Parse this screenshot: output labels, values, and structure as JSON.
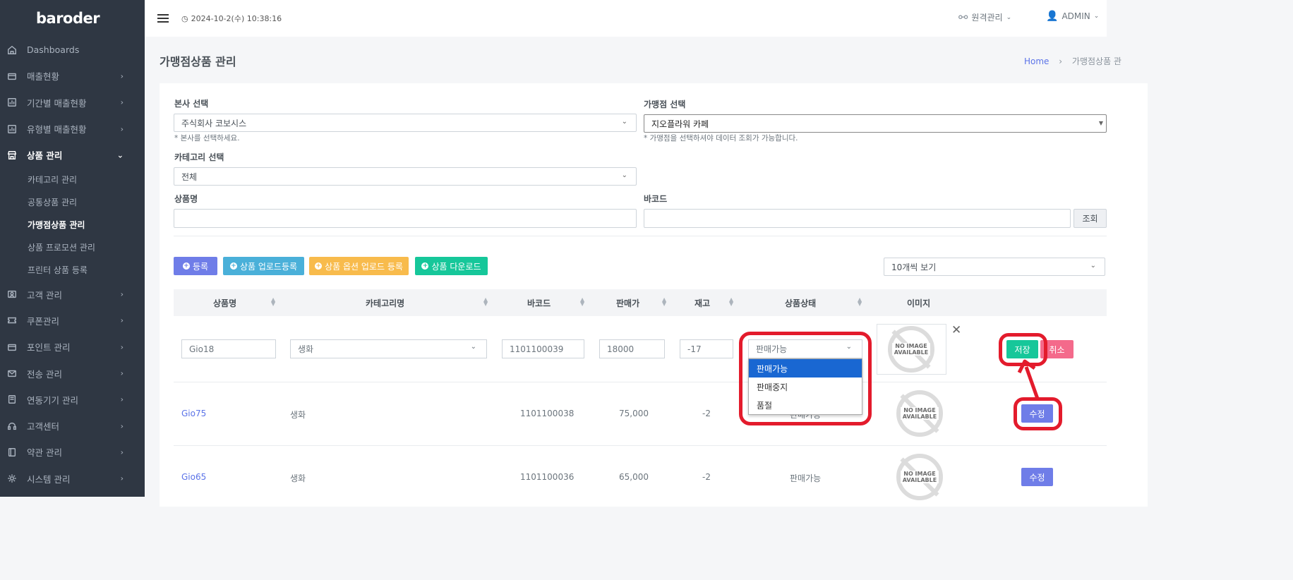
{
  "app": {
    "logo": "baroder"
  },
  "topbar": {
    "datetime": "2024-10-2(수) 10:38:16",
    "remote": "원격관리",
    "admin": "ADMIN"
  },
  "sidebar": {
    "items": [
      {
        "label": "Dashboards",
        "icon": "home-icon"
      },
      {
        "label": "매출현황",
        "icon": "wallet-icon"
      },
      {
        "label": "기간별 매출현황",
        "icon": "chart-icon"
      },
      {
        "label": "유형별 매출현황",
        "icon": "chart-icon"
      },
      {
        "label": "상품 관리",
        "icon": "store-icon"
      },
      {
        "label": "고객 관리",
        "icon": "user-card-icon"
      },
      {
        "label": "쿠폰관리",
        "icon": "ticket-icon"
      },
      {
        "label": "포인트 관리",
        "icon": "wallet-icon"
      },
      {
        "label": "전송 관리",
        "icon": "mail-icon"
      },
      {
        "label": "연동기기 관리",
        "icon": "device-icon"
      },
      {
        "label": "고객센터",
        "icon": "headset-icon"
      },
      {
        "label": "약관 관리",
        "icon": "book-icon"
      },
      {
        "label": "시스템 관리",
        "icon": "gear-icon"
      }
    ],
    "subitems": [
      "카테고리 관리",
      "공통상품 관리",
      "가맹점상품 관리",
      "상품 프로모션 관리",
      "프린터 상품 등록"
    ]
  },
  "page": {
    "title": "가맹점상품 관리",
    "breadcrumb_home": "Home",
    "breadcrumb_sep": "›",
    "breadcrumb_current": "가맹점상품 관"
  },
  "filters": {
    "hq_label": "본사 선택",
    "hq_value": "주식회사 코보시스",
    "hq_hint": "* 본사를 선택하세요.",
    "store_label": "가맹점 선택",
    "store_value": "지오플라워 카페",
    "store_hint": "* 가맹점을 선택하셔야 데이터 조회가 가능합니다.",
    "category_label": "카테고리 선택",
    "category_value": "전체",
    "name_label": "상품명",
    "name_value": "",
    "barcode_label": "바코드",
    "barcode_value": "",
    "search_button": "조회"
  },
  "actions": {
    "register": "등록",
    "upload": "상품 업로드등록",
    "option_upload": "상품 옵션 업로드 등록",
    "download": "상품 다운로드",
    "page_size": "10개씩 보기"
  },
  "table": {
    "headers": [
      "상품명",
      "카테고리명",
      "바코드",
      "판매가",
      "재고",
      "상품상태",
      "이미지"
    ],
    "edit_row": {
      "name": "Gio18",
      "category": "생화",
      "barcode": "1101100039",
      "price": "18000",
      "stock": "-17",
      "status": "판매가능",
      "save": "저장",
      "cancel": "취소"
    },
    "status_options": [
      "판매가능",
      "판매중지",
      "품절"
    ],
    "rows": [
      {
        "name": "Gio75",
        "category": "생화",
        "barcode": "1101100038",
        "price": "75,000",
        "stock": "-2",
        "status": "판매가능",
        "action": "수정"
      },
      {
        "name": "Gio65",
        "category": "생화",
        "barcode": "1101100036",
        "price": "65,000",
        "stock": "-2",
        "status": "판매가능",
        "action": "수정"
      }
    ],
    "no_image": "NO IMAGE AVAILABLE"
  }
}
